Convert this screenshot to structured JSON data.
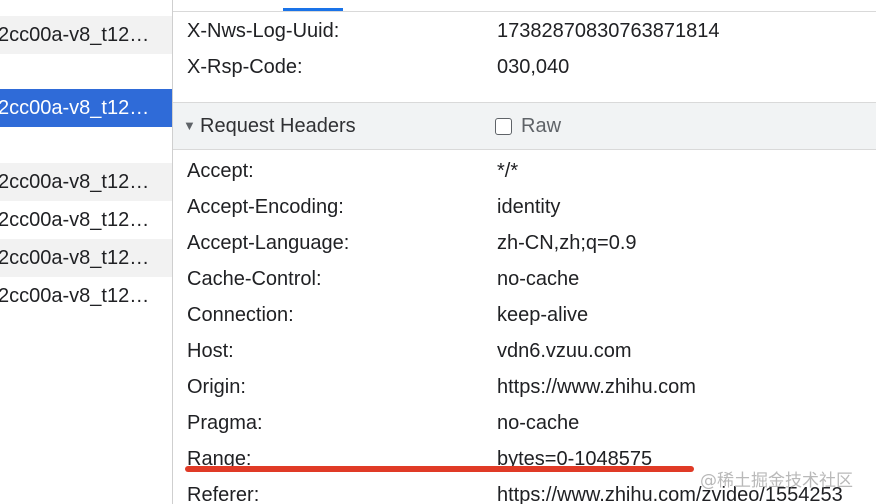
{
  "request_list": [
    {
      "name": "2cc00a-v8_t12…",
      "style": "alt"
    },
    {
      "name": "",
      "style": "plain"
    },
    {
      "name": "2cc00a-v8_t12…",
      "style": "selected"
    },
    {
      "name": "",
      "style": "plain"
    },
    {
      "name": "2cc00a-v8_t12…",
      "style": "alt"
    },
    {
      "name": "2cc00a-v8_t12…",
      "style": "plain"
    },
    {
      "name": "2cc00a-v8_t12…",
      "style": "alt"
    },
    {
      "name": "2cc00a-v8_t12…",
      "style": "plain"
    }
  ],
  "response_headers": [
    {
      "key": "X-Nws-Log-Uuid:",
      "value": "17382870830763871814"
    },
    {
      "key": "X-Rsp-Code:",
      "value": "030,040"
    }
  ],
  "request_section": {
    "title": "Request Headers",
    "raw_label": "Raw"
  },
  "request_headers": [
    {
      "key": "Accept:",
      "value": "*/*"
    },
    {
      "key": "Accept-Encoding:",
      "value": "identity"
    },
    {
      "key": "Accept-Language:",
      "value": "zh-CN,zh;q=0.9"
    },
    {
      "key": "Cache-Control:",
      "value": "no-cache"
    },
    {
      "key": "Connection:",
      "value": "keep-alive"
    },
    {
      "key": "Host:",
      "value": "vdn6.vzuu.com"
    },
    {
      "key": "Origin:",
      "value": "https://www.zhihu.com"
    },
    {
      "key": "Pragma:",
      "value": "no-cache"
    },
    {
      "key": "Range:",
      "value": "bytes=0-1048575"
    },
    {
      "key": "Referer:",
      "value": "https://www.zhihu.com/zvideo/1554253"
    }
  ],
  "watermark": "@稀土掘金技术社区",
  "colors": {
    "selected": "#2f6bd8",
    "highlight": "#e03a26",
    "section_bg": "#f1f3f4"
  }
}
